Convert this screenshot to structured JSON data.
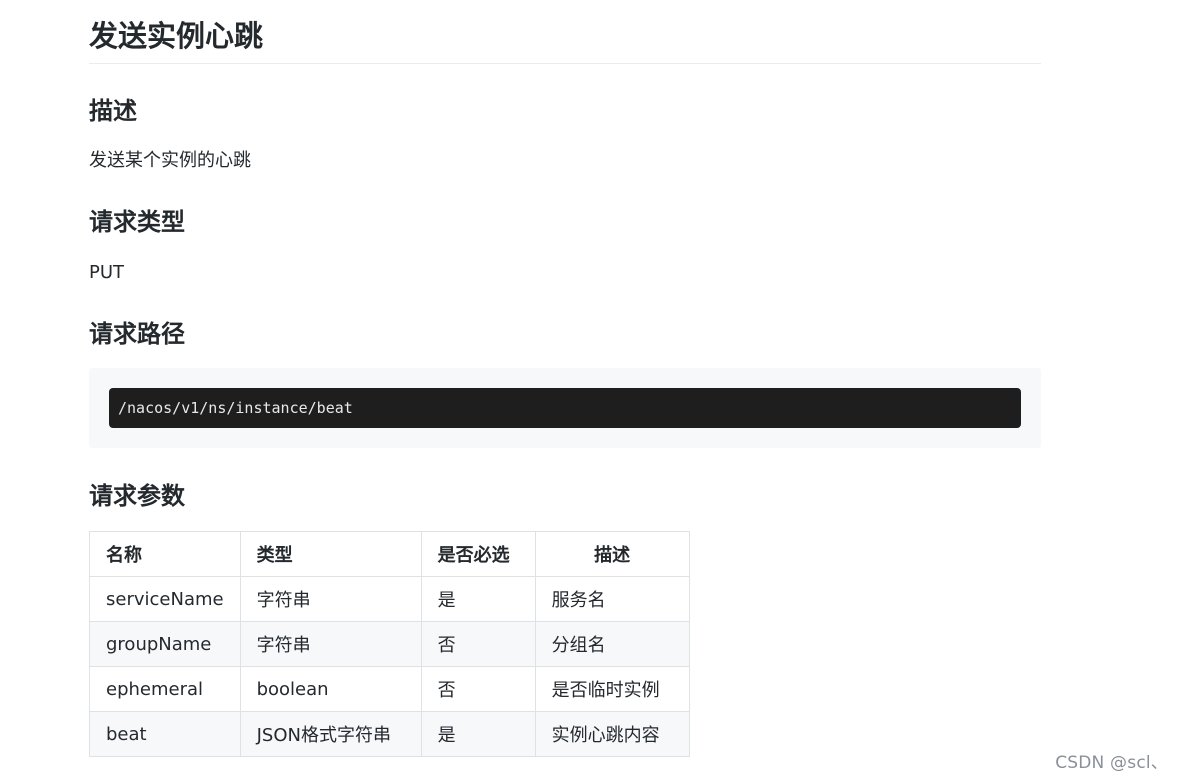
{
  "title": "发送实例心跳",
  "sections": {
    "description": {
      "heading": "描述",
      "text": "发送某个实例的心跳"
    },
    "request_type": {
      "heading": "请求类型",
      "text": "PUT"
    },
    "request_path": {
      "heading": "请求路径",
      "code": "/nacos/v1/ns/instance/beat"
    },
    "request_params": {
      "heading": "请求参数",
      "table": {
        "headers": [
          "名称",
          "类型",
          "是否必选",
          "描述"
        ],
        "rows": [
          [
            "serviceName",
            "字符串",
            "是",
            "服务名"
          ],
          [
            "groupName",
            "字符串",
            "否",
            "分组名"
          ],
          [
            "ephemeral",
            "boolean",
            "否",
            "是否临时实例"
          ],
          [
            "beat",
            "JSON格式字符串",
            "是",
            "实例心跳内容"
          ]
        ]
      }
    }
  },
  "watermark": "CSDN @scl、",
  "colors": {
    "text": "#24292e",
    "code_background": "#1e1e1e",
    "code_wrap_background": "#f6f8fa",
    "table_border": "#dfe2e5",
    "table_stripe": "#f6f8fa"
  }
}
